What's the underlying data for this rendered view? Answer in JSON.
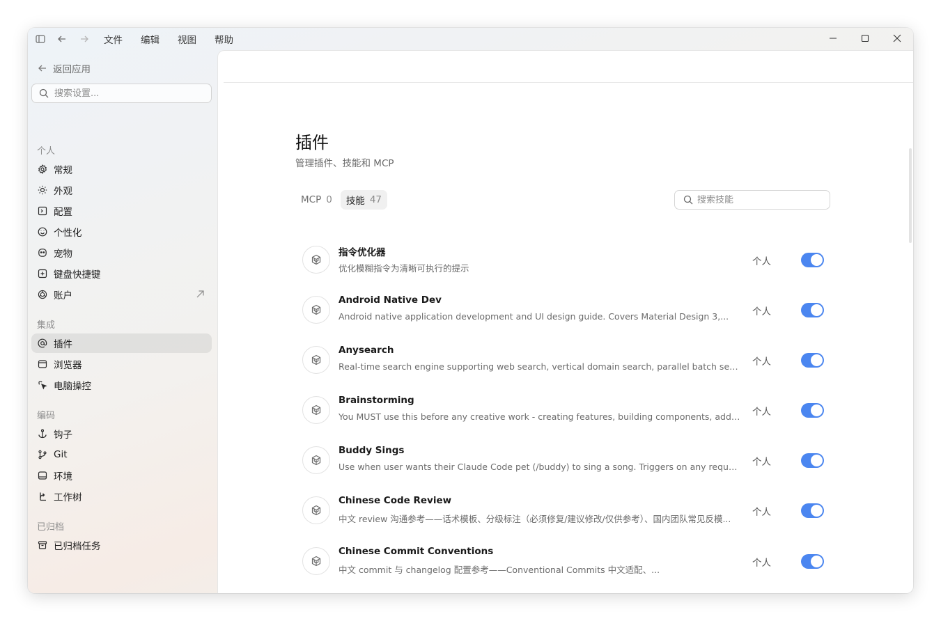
{
  "menu": [
    "文件",
    "编辑",
    "视图",
    "帮助"
  ],
  "sidebar": {
    "back_label": "返回应用",
    "search_placeholder": "搜索设置...",
    "sections": {
      "personal": "个人",
      "integration": "集成",
      "coding": "编码",
      "archived": "已归档"
    },
    "items": {
      "general": "常规",
      "appearance": "外观",
      "config": "配置",
      "personalization": "个性化",
      "pet": "宠物",
      "shortcuts": "键盘快捷键",
      "account": "账户",
      "plugins": "插件",
      "browser": "浏览器",
      "computer_control": "电脑操控",
      "hooks": "钩子",
      "git": "Git",
      "environment": "环境",
      "worktree": "工作树",
      "archived_tasks": "已归档任务"
    }
  },
  "main": {
    "title": "插件",
    "subtitle": "管理插件、技能和 MCP",
    "tabs": [
      {
        "label": "MCP",
        "count": "0"
      },
      {
        "label": "技能",
        "count": "47"
      }
    ],
    "search_placeholder": "搜索技能",
    "skills": [
      {
        "name": "指令优化器",
        "desc": "优化模糊指令为清晰可执行的提示",
        "scope": "个人",
        "enabled": true
      },
      {
        "name": "Android Native Dev",
        "desc": "Android native application development and UI design guide. Covers Material Design 3,...",
        "scope": "个人",
        "enabled": true
      },
      {
        "name": "Anysearch",
        "desc": "Real-time search engine supporting web search, vertical domain search, parallel batch search, and...",
        "scope": "个人",
        "enabled": true
      },
      {
        "name": "Brainstorming",
        "desc": "You MUST use this before any creative work - creating features, building components, adding...",
        "scope": "个人",
        "enabled": true
      },
      {
        "name": "Buddy Sings",
        "desc": "Use when user wants their Claude Code pet (/buddy) to sing a song. Triggers on any request that...",
        "scope": "个人",
        "enabled": true
      },
      {
        "name": "Chinese Code Review",
        "desc": "中文 review 沟通参考——话术模板、分级标注（必须修复/建议修改/仅供参考）、国内团队常见反模...",
        "scope": "个人",
        "enabled": true
      },
      {
        "name": "Chinese Commit Conventions",
        "desc": "中文 commit 与 changelog 配置参考——Conventional Commits 中文适配、...",
        "scope": "个人",
        "enabled": true
      }
    ]
  },
  "colors": {
    "accent": "#4b86f0",
    "active_item_bg": "#ebebeb"
  }
}
